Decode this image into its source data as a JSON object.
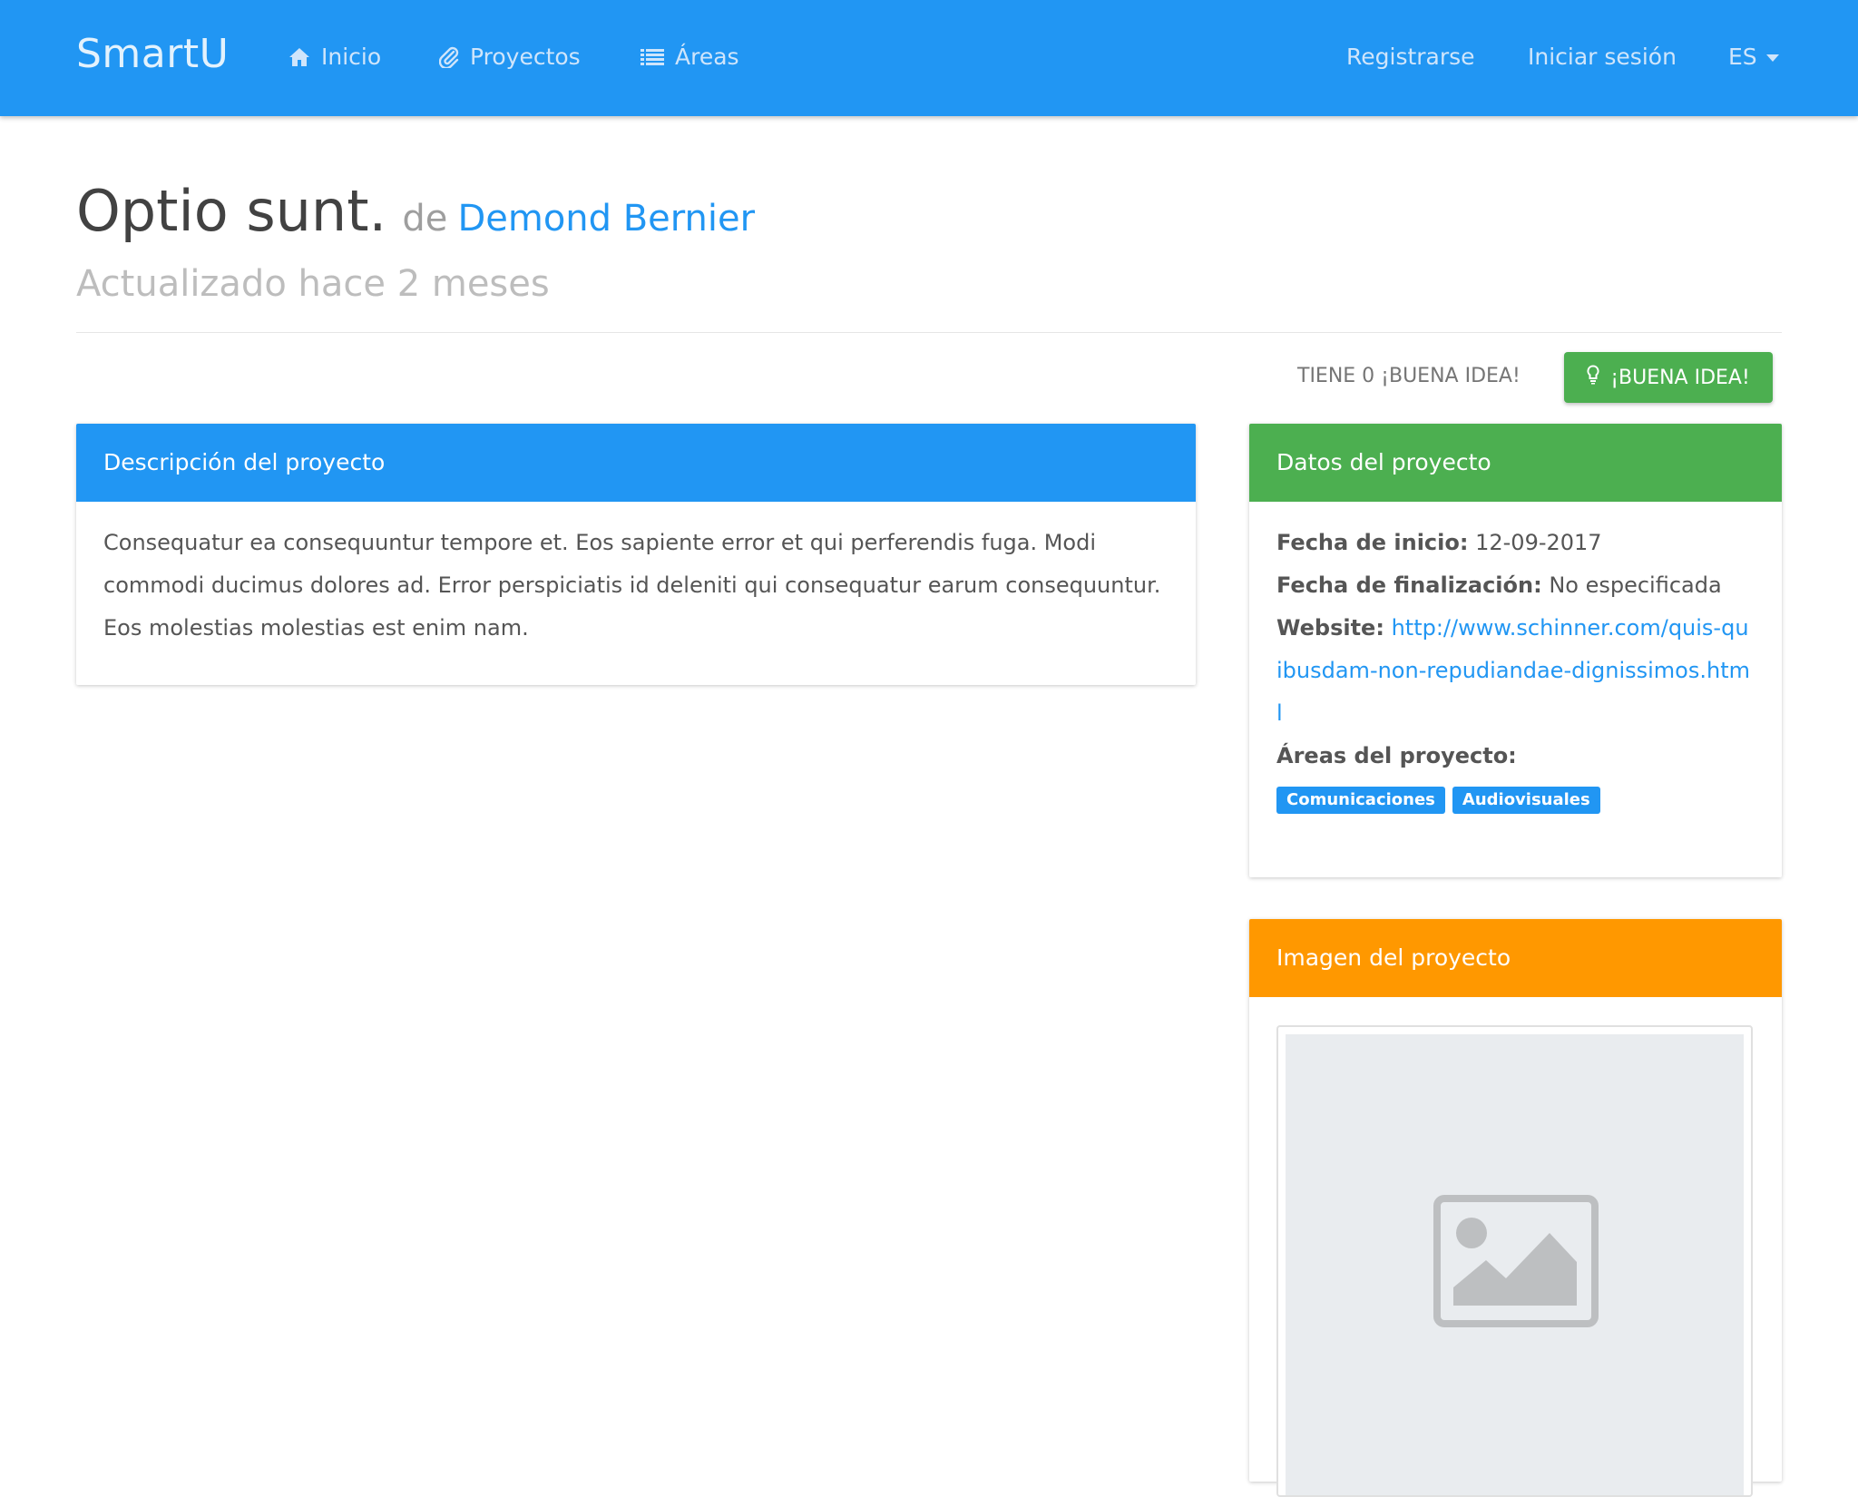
{
  "navbar": {
    "brand": "SmartU",
    "links": [
      {
        "label": "Inicio",
        "icon": "home-icon"
      },
      {
        "label": "Proyectos",
        "icon": "paperclip-icon"
      },
      {
        "label": "Áreas",
        "icon": "list-icon"
      }
    ],
    "register": "Registrarse",
    "login": "Iniciar sesión",
    "language": "ES"
  },
  "project": {
    "title": "Optio sunt.",
    "by": "de",
    "author": "Demond Bernier",
    "updated": "Actualizado hace 2 meses"
  },
  "ideas": {
    "count_text": "TIENE 0 ¡BUENA IDEA!",
    "button_label": "¡BUENA IDEA!"
  },
  "description_panel": {
    "title": "Descripción del proyecto",
    "text": "Consequatur ea consequuntur tempore et. Eos sapiente error et qui perferendis fuga. Modi commodi ducimus dolores ad. Error perspiciatis id deleniti qui consequatur earum consequuntur. Eos molestias molestias est enim nam."
  },
  "data_panel": {
    "title": "Datos del proyecto",
    "start_label": "Fecha de inicio:",
    "start_value": "12-09-2017",
    "end_label": "Fecha de finalización:",
    "end_value": "No especificada",
    "website_label": "Website:",
    "website_value": "http://www.schinner.com/quis-quibusdam-non-repudiandae-dignissimos.html",
    "areas_label": "Áreas del proyecto:",
    "areas": [
      "Comunicaciones",
      "Audiovisuales"
    ]
  },
  "image_panel": {
    "title": "Imagen del proyecto",
    "placeholder_icon": "image-placeholder-icon"
  },
  "colors": {
    "primary": "#2196f3",
    "success": "#4caf50",
    "warning": "#ff9800"
  }
}
